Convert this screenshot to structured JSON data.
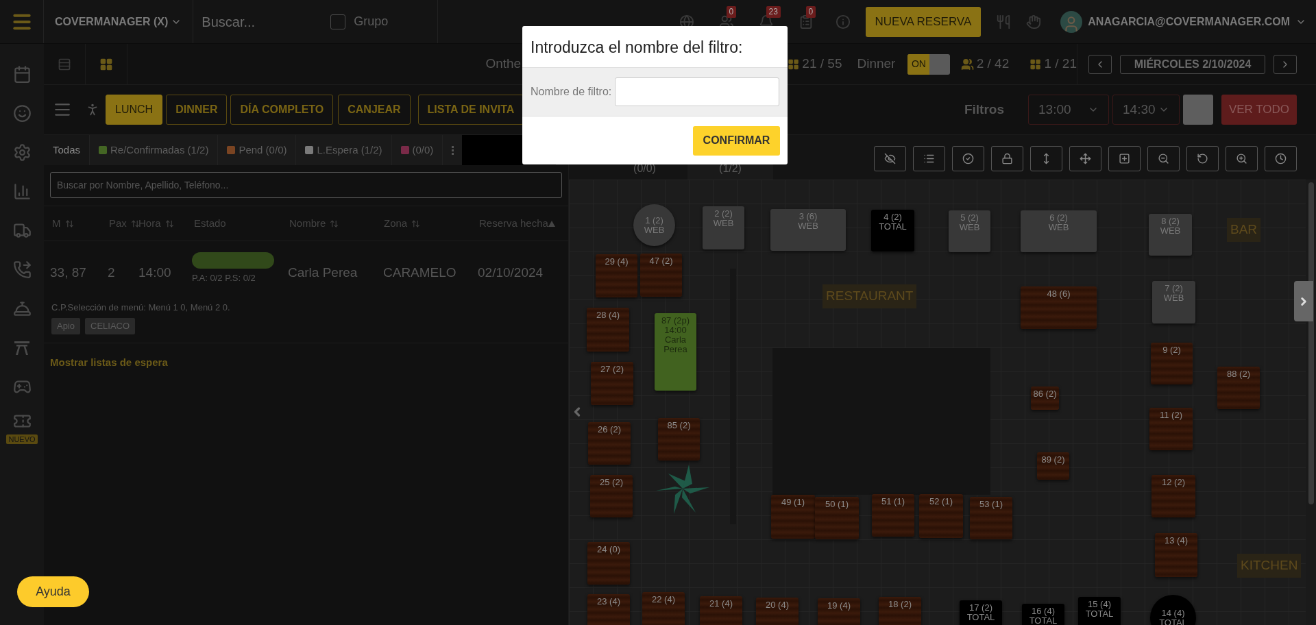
{
  "top_bar": {
    "venue": "COVERMANAGER (X)",
    "search": {
      "placeholder": "Buscar..."
    },
    "group_checkbox": {
      "label": "Grupo",
      "checked": false
    },
    "notifications": [
      {
        "count": "0"
      },
      {
        "count": "23"
      },
      {
        "count": "0"
      }
    ],
    "new_booking": "NUEVA RESERVA",
    "user_email": "ANAGARCIA@COVERMANAGER.COM"
  },
  "sidebar": {
    "new_badge": "NUEVO"
  },
  "view_bar": {
    "partial_text": "Onthe",
    "covers": "21 / 55",
    "service": "Dinner",
    "toggle": {
      "label": "ON",
      "on": true
    },
    "guests": "2 / 42",
    "tables": "1 / 21",
    "date": "MIÉRCOLES 2/10/2024"
  },
  "services": [
    {
      "label": "LUNCH",
      "selected": true
    },
    {
      "label": "DINNER",
      "selected": false
    },
    {
      "label": "DÍA COMPLETO",
      "selected": false
    },
    {
      "label": "CANJEAR",
      "selected": false
    },
    {
      "label": "LISTA DE INVITA",
      "selected": false
    }
  ],
  "filters": {
    "label": "Filtros",
    "from": "13:00",
    "to": "14:30",
    "reset": "VER TODO"
  },
  "status_tabs": [
    {
      "label": "Todas",
      "selected": true
    },
    {
      "label": "Re/Confirmadas (1/2)",
      "selected": false,
      "color": "#446624"
    },
    {
      "label": "Pend (0/0)",
      "selected": false,
      "color": "#7a4422"
    },
    {
      "label": "L.Espera (1/2)",
      "selected": false,
      "color": "#7a7a7a"
    },
    {
      "label": "(0/0)",
      "selected": false,
      "color": "#7a2a48"
    }
  ],
  "map_tabs": [
    {
      "label": "(0/0)"
    },
    {
      "label": "(1/2)"
    }
  ],
  "list_search": {
    "placeholder": "Buscar por Nombre, Apellido, Teléfono..."
  },
  "columns": [
    {
      "label": "M",
      "kind": "sortable"
    },
    {
      "label": "Pax",
      "kind": "sortable"
    },
    {
      "label": "Hora",
      "kind": "sortable"
    },
    {
      "label": "Estado",
      "kind": "plain"
    },
    {
      "label": "Nombre",
      "kind": "sortable"
    },
    {
      "label": "Zona",
      "kind": "sortable"
    },
    {
      "label": "Reserva hecha",
      "kind": "sorted"
    }
  ],
  "reservation": {
    "tables": "33, 87",
    "pax": "2",
    "time": "14:00",
    "color": "#31491a",
    "payment": "P.A: 0/2 P.S: 0/2",
    "name": "Carla Perea",
    "zone": "CARAMELO",
    "made": "02/10/2024",
    "note": "C.P.Selección de menú: Menú 1 0, Menú 2 0.",
    "tags": [
      "Apio",
      "CELIACO"
    ]
  },
  "waitlist_link": "Mostrar listas de espera",
  "floor": {
    "zones": [
      "BAR",
      "RESTAURANT",
      "KITCHEN"
    ],
    "tables": [
      {
        "label": "1 (2)",
        "sub": "WEB",
        "kind": "web",
        "round": true
      },
      {
        "label": "2 (2)",
        "sub": "WEB",
        "kind": "web",
        "round": false
      },
      {
        "label": "3 (6)",
        "sub": "WEB",
        "kind": "web",
        "round": false
      },
      {
        "label": "4 (2)",
        "sub": "TOTAL",
        "kind": "total",
        "round": false
      },
      {
        "label": "5 (2)",
        "sub": "WEB",
        "kind": "web",
        "round": false
      },
      {
        "label": "6 (2)",
        "sub": "WEB",
        "kind": "web",
        "round": false
      },
      {
        "label": "8 (2)",
        "sub": "WEB",
        "kind": "web",
        "round": false
      },
      {
        "label": "29 (4)",
        "kind": "wood",
        "round": false
      },
      {
        "label": "47 (2)",
        "kind": "wood",
        "round": false
      },
      {
        "label": "48 (6)",
        "kind": "wood",
        "round": false
      },
      {
        "label": "7 (2)",
        "sub": "WEB",
        "kind": "web",
        "round": false
      },
      {
        "label": "28 (4)",
        "kind": "wood",
        "round": false
      },
      {
        "label": "87 (2p)",
        "sub": "14:00 Carla Perea",
        "kind": "booked",
        "round": false
      },
      {
        "label": "27 (2)",
        "kind": "wood",
        "round": false
      },
      {
        "label": "9 (2)",
        "kind": "wood",
        "round": false
      },
      {
        "label": "88 (2)",
        "kind": "wood",
        "round": false
      },
      {
        "label": "86 (2)",
        "kind": "wood",
        "round": false
      },
      {
        "label": "26 (2)",
        "kind": "wood",
        "round": false
      },
      {
        "label": "85 (2)",
        "kind": "wood",
        "round": false
      },
      {
        "label": "11 (2)",
        "kind": "wood",
        "round": false
      },
      {
        "label": "89 (2)",
        "kind": "wood",
        "round": false
      },
      {
        "label": "25 (2)",
        "kind": "wood",
        "round": false
      },
      {
        "label": "12 (2)",
        "kind": "wood",
        "round": false
      },
      {
        "label": "49 (1)",
        "kind": "wood",
        "round": false
      },
      {
        "label": "50 (1)",
        "kind": "wood",
        "round": false
      },
      {
        "label": "51 (1)",
        "kind": "wood",
        "round": false
      },
      {
        "label": "52 (1)",
        "kind": "wood",
        "round": false
      },
      {
        "label": "53 (1)",
        "kind": "wood",
        "round": false
      },
      {
        "label": "13 (4)",
        "kind": "wood",
        "round": false
      },
      {
        "label": "24 (0)",
        "kind": "wood",
        "round": false
      },
      {
        "label": "23 (4)",
        "kind": "wood",
        "round": false
      },
      {
        "label": "22 (4)",
        "kind": "wood",
        "round": false
      },
      {
        "label": "21 (4)",
        "kind": "wood",
        "round": false
      },
      {
        "label": "20 (4)",
        "kind": "wood",
        "round": false
      },
      {
        "label": "19 (4)",
        "kind": "wood",
        "round": false
      },
      {
        "label": "18 (2)",
        "kind": "wood",
        "round": false
      },
      {
        "label": "17 (2)",
        "sub": "TOTAL",
        "kind": "total",
        "round": false
      },
      {
        "label": "16 (4)",
        "sub": "TOTAL",
        "kind": "total",
        "round": false
      },
      {
        "label": "15 (4)",
        "sub": "TOTAL",
        "kind": "total",
        "round": false
      },
      {
        "label": "14 (4)",
        "sub": "TOTAL",
        "kind": "total",
        "round": true
      }
    ]
  },
  "modal": {
    "title": "Introduzca el nombre del filtro:",
    "field_label": "Nombre de filtro:",
    "confirm": "CONFIRMAR"
  },
  "help": "Ayuda"
}
